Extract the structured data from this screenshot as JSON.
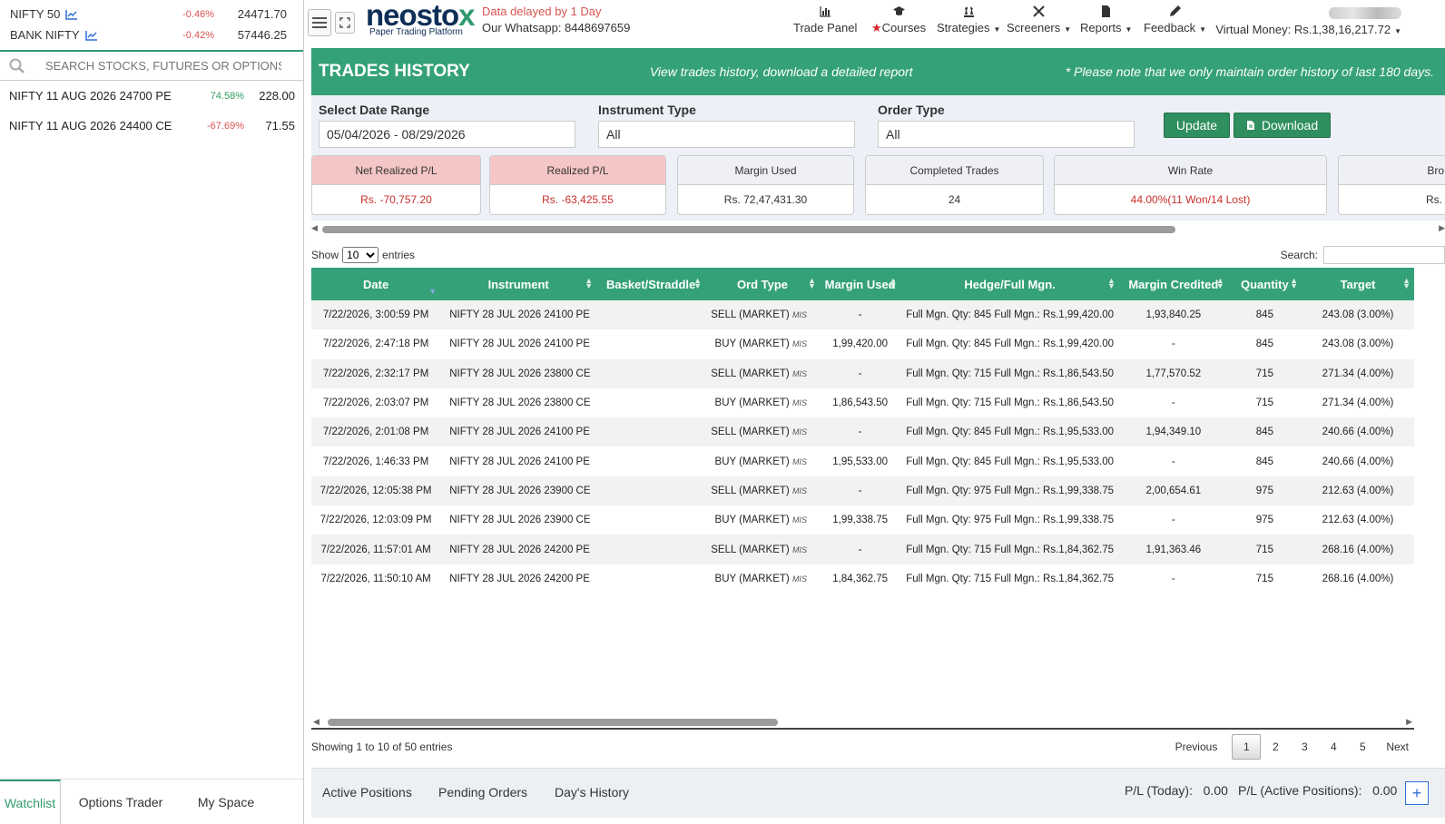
{
  "indices": [
    {
      "name": "NIFTY 50",
      "change": "-0.46%",
      "price": "24471.70"
    },
    {
      "name": "BANK NIFTY",
      "change": "-0.42%",
      "price": "57446.25"
    }
  ],
  "search": {
    "placeholder": "SEARCH STOCKS, FUTURES OR OPTIONS"
  },
  "watchlist": [
    {
      "name": "NIFTY 11 AUG 2026 24700 PE",
      "change": "74.58%",
      "price": "228.00"
    },
    {
      "name": "NIFTY 11 AUG 2026 24400 CE",
      "change": "-67.69%",
      "price": "71.55"
    }
  ],
  "left_tabs": [
    "Watchlist",
    "Options Trader",
    "My Space"
  ],
  "header": {
    "logo_main": "neosto",
    "logo_x": "x",
    "logo_sub": "Paper Trading Platform",
    "delay": "Data delayed by 1 Day",
    "whatsapp": "Our Whatsapp: 8448697659",
    "nav": [
      "Trade Panel",
      "Courses",
      "Strategies",
      "Screeners",
      "Reports",
      "Feedback"
    ],
    "virtual_money_label": "Virtual Money: ",
    "virtual_money_value": "Rs.1,38,16,217.72"
  },
  "page": {
    "title": "TRADES HISTORY",
    "subtitle": "View trades history, download a detailed report",
    "note": "* Please note that we only maintain order history of last 180 days."
  },
  "filters": {
    "date_label": "Select Date Range",
    "date_value": "05/04/2026 - 08/29/2026",
    "instrument_label": "Instrument Type",
    "instrument_value": "All",
    "order_label": "Order Type",
    "order_value": "All",
    "update": "Update",
    "download": "Download"
  },
  "stats": [
    {
      "label": "Net Realized P/L",
      "value": "Rs. -70,757.20"
    },
    {
      "label": "Realized P/L",
      "value": "Rs. -63,425.55"
    },
    {
      "label": "Margin Used",
      "value": "Rs. 72,47,431.30"
    },
    {
      "label": "Completed Trades",
      "value": "24"
    },
    {
      "label": "Win Rate",
      "value": "44.00%",
      "value_extra": " (11 Won/14 Lost)"
    },
    {
      "label": "Bro",
      "value": "Rs."
    }
  ],
  "table": {
    "show_label": "Show",
    "show_value": "10",
    "entries_label": "entries",
    "search_label": "Search:",
    "columns": [
      "Date",
      "Instrument",
      "Basket/Straddle",
      "Ord Type",
      "Margin Used",
      "Hedge/Full Mgn.",
      "Margin Credited",
      "Quantity",
      "Target"
    ],
    "rows": [
      [
        "7/22/2026, 3:00:59 PM",
        "NIFTY 28 JUL 2026 24100 PE",
        "",
        "SELL (MARKET)",
        "MIS",
        "-",
        "Full Mgn. Qty: 845 Full Mgn.: Rs.1,99,420.00",
        "1,93,840.25",
        "845",
        "243.08 (3.00%)"
      ],
      [
        "7/22/2026, 2:47:18 PM",
        "NIFTY 28 JUL 2026 24100 PE",
        "",
        "BUY (MARKET)",
        "MIS",
        "1,99,420.00",
        "Full Mgn. Qty: 845 Full Mgn.: Rs.1,99,420.00",
        "-",
        "845",
        "243.08 (3.00%)"
      ],
      [
        "7/22/2026, 2:32:17 PM",
        "NIFTY 28 JUL 2026 23800 CE",
        "",
        "SELL (MARKET)",
        "MIS",
        "-",
        "Full Mgn. Qty: 715 Full Mgn.: Rs.1,86,543.50",
        "1,77,570.52",
        "715",
        "271.34 (4.00%)"
      ],
      [
        "7/22/2026, 2:03:07 PM",
        "NIFTY 28 JUL 2026 23800 CE",
        "",
        "BUY (MARKET)",
        "MIS",
        "1,86,543.50",
        "Full Mgn. Qty: 715 Full Mgn.: Rs.1,86,543.50",
        "-",
        "715",
        "271.34 (4.00%)"
      ],
      [
        "7/22/2026, 2:01:08 PM",
        "NIFTY 28 JUL 2026 24100 PE",
        "",
        "SELL (MARKET)",
        "MIS",
        "-",
        "Full Mgn. Qty: 845 Full Mgn.: Rs.1,95,533.00",
        "1,94,349.10",
        "845",
        "240.66 (4.00%)"
      ],
      [
        "7/22/2026, 1:46:33 PM",
        "NIFTY 28 JUL 2026 24100 PE",
        "",
        "BUY (MARKET)",
        "MIS",
        "1,95,533.00",
        "Full Mgn. Qty: 845 Full Mgn.: Rs.1,95,533.00",
        "-",
        "845",
        "240.66 (4.00%)"
      ],
      [
        "7/22/2026, 12:05:38 PM",
        "NIFTY 28 JUL 2026 23900 CE",
        "",
        "SELL (MARKET)",
        "MIS",
        "-",
        "Full Mgn. Qty: 975 Full Mgn.: Rs.1,99,338.75",
        "2,00,654.61",
        "975",
        "212.63 (4.00%)"
      ],
      [
        "7/22/2026, 12:03:09 PM",
        "NIFTY 28 JUL 2026 23900 CE",
        "",
        "BUY (MARKET)",
        "MIS",
        "1,99,338.75",
        "Full Mgn. Qty: 975 Full Mgn.: Rs.1,99,338.75",
        "-",
        "975",
        "212.63 (4.00%)"
      ],
      [
        "7/22/2026, 11:57:01 AM",
        "NIFTY 28 JUL 2026 24200 PE",
        "",
        "SELL (MARKET)",
        "MIS",
        "-",
        "Full Mgn. Qty: 715 Full Mgn.: Rs.1,84,362.75",
        "1,91,363.46",
        "715",
        "268.16 (4.00%)"
      ],
      [
        "7/22/2026, 11:50:10 AM",
        "NIFTY 28 JUL 2026 24200 PE",
        "",
        "BUY (MARKET)",
        "MIS",
        "1,84,362.75",
        "Full Mgn. Qty: 715 Full Mgn.: Rs.1,84,362.75",
        "-",
        "715",
        "268.16 (4.00%)"
      ]
    ],
    "info": "Showing 1 to 10 of 50 entries",
    "pager": [
      "Previous",
      "1",
      "2",
      "3",
      "4",
      "5",
      "Next"
    ]
  },
  "bottom": {
    "tabs": [
      "Active Positions",
      "Pending Orders",
      "Day's History"
    ],
    "pl_today_label": "P/L (Today):",
    "pl_today_value": "0.00",
    "pl_active_label": "P/L (Active Positions):",
    "pl_active_value": "0.00",
    "plus": "+"
  },
  "colors": {
    "brand_green": "#34a178",
    "negative": "#d9534f",
    "positive": "#2e9a5e"
  }
}
